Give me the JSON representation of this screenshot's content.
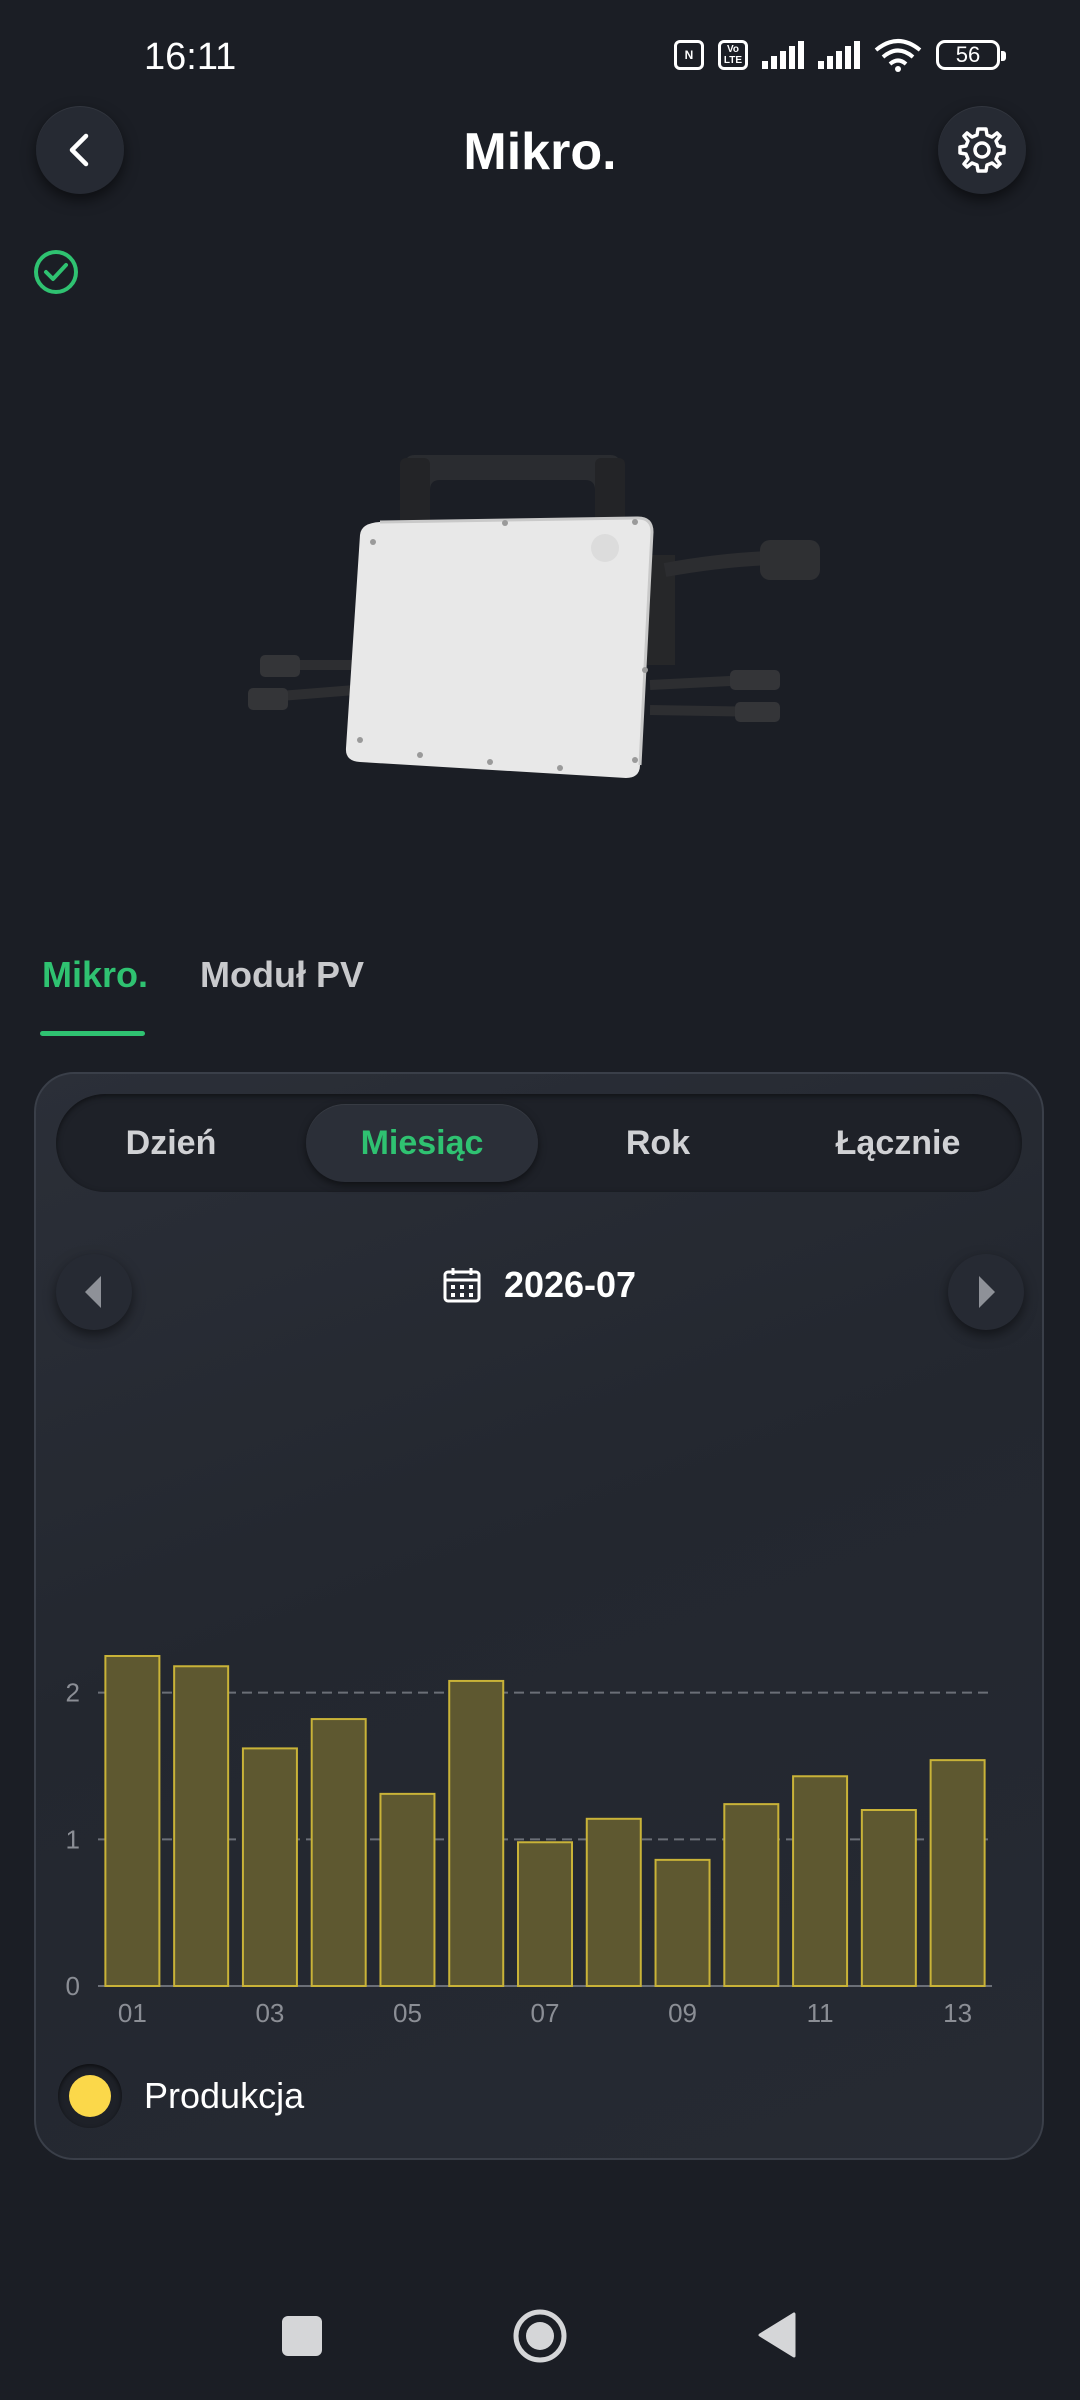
{
  "status_bar": {
    "time": "16:11",
    "battery": "56",
    "network": "VoLTE",
    "wifi_badge": "6"
  },
  "header": {
    "title": "Mikro.",
    "back_icon": "chevron-left-icon",
    "settings_icon": "gear-icon"
  },
  "device": {
    "status_icon": "check-circle-icon",
    "status_color": "#2fc271"
  },
  "tabs": [
    {
      "label": "Mikro.",
      "active": true
    },
    {
      "label": "Moduł PV",
      "active": false
    }
  ],
  "periods": [
    {
      "label": "Dzień",
      "selected": false
    },
    {
      "label": "Miesiąc",
      "selected": true
    },
    {
      "label": "Rok",
      "selected": false
    },
    {
      "label": "Łącznie",
      "selected": false
    }
  ],
  "date_nav": {
    "date": "2026-07",
    "calendar_icon": "calendar-icon"
  },
  "chart_data": {
    "type": "bar",
    "categories": [
      "01",
      "02",
      "03",
      "04",
      "05",
      "06",
      "07",
      "08",
      "09",
      "10",
      "11",
      "12",
      "13"
    ],
    "visible_tick_labels": [
      "01",
      "03",
      "05",
      "07",
      "09",
      "11",
      "13"
    ],
    "values": [
      2.25,
      2.18,
      1.62,
      1.82,
      1.31,
      2.08,
      0.98,
      1.14,
      0.86,
      1.24,
      1.43,
      1.2,
      1.54
    ],
    "yticks": [
      0,
      1,
      2
    ],
    "ylim": [
      0,
      2.4
    ],
    "grid": "dashed horizontal at 1 and 2",
    "series": [
      {
        "name": "Produkcja",
        "color": "#fbd84a"
      }
    ],
    "legend": "bottom-left"
  },
  "accent_color": "#2fc271"
}
